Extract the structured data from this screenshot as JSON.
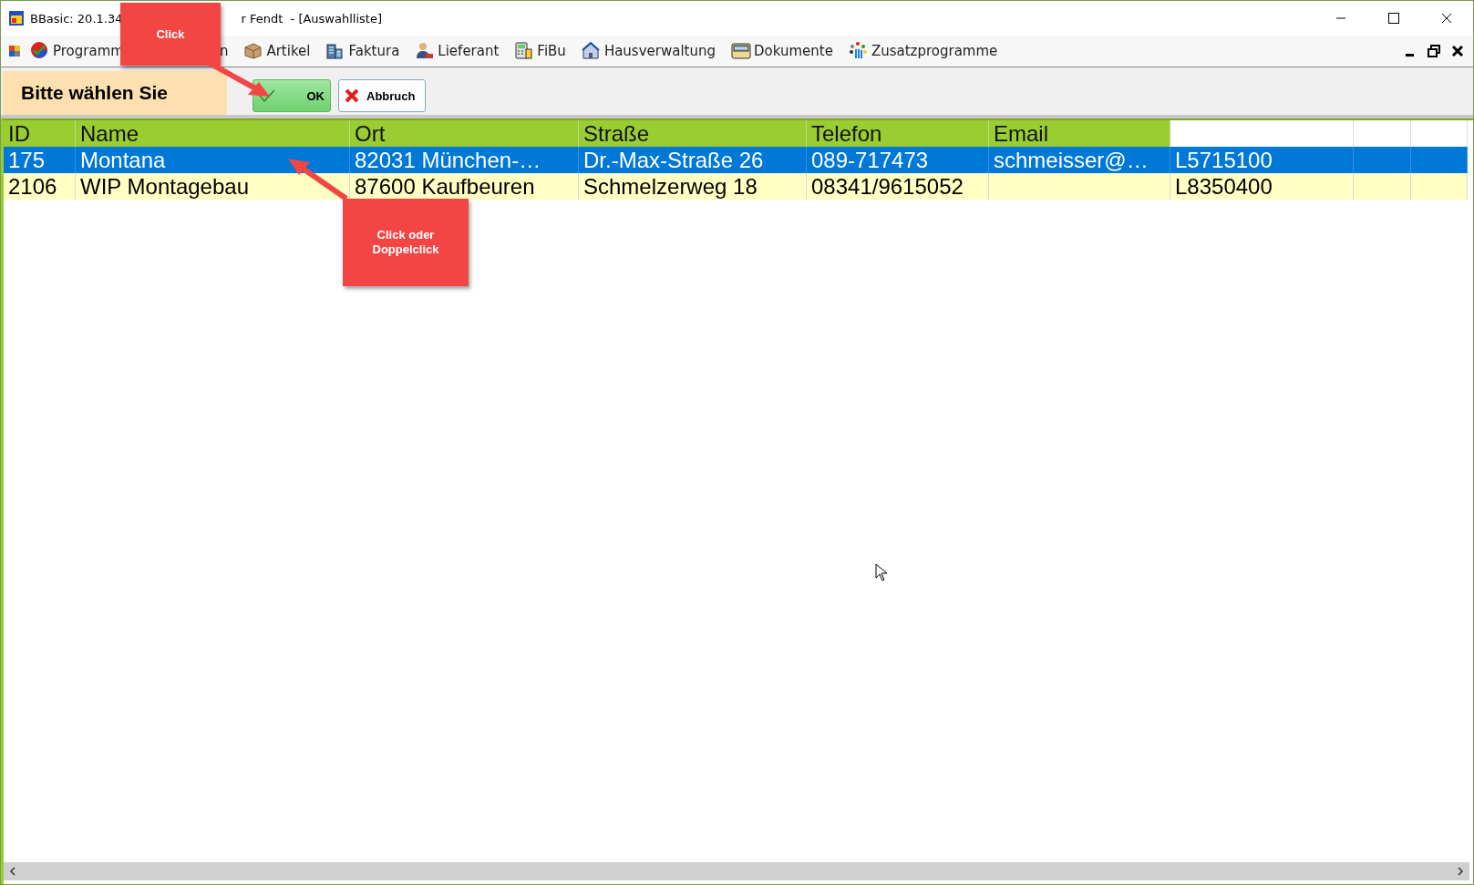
{
  "window": {
    "title_parts": [
      "BBasic: 20.1.34",
      "r Fendt  - [Auswahlliste]"
    ]
  },
  "menu": [
    {
      "label": "Programm"
    },
    {
      "label": "n"
    },
    {
      "label": "Artikel"
    },
    {
      "label": "Faktura"
    },
    {
      "label": "Lieferant"
    },
    {
      "label": "FiBu"
    },
    {
      "label": "Hausverwaltung"
    },
    {
      "label": "Dokumente"
    },
    {
      "label": "Zusatzprogramme"
    }
  ],
  "toolbar": {
    "heading": "Bitte wählen Sie",
    "buttons": [
      {
        "label": "OK",
        "kind": "ok"
      },
      {
        "label": "Abbruch",
        "kind": "cancel"
      }
    ]
  },
  "table": {
    "columns": [
      "ID",
      "Name",
      "Ort",
      "Straße",
      "Telefon",
      "Email"
    ],
    "rows": [
      {
        "selected": true,
        "cells": [
          "175",
          "Montana",
          "82031  München-…",
          "Dr.-Max-Straße 26",
          "089-717473",
          "schmeisser@…",
          "L5715100"
        ]
      },
      {
        "selected": false,
        "cells": [
          "2106",
          "WIP Montagebau",
          "87600 Kaufbeuren",
          "Schmelzerweg 18",
          "08341/9615052",
          "",
          "L8350400"
        ]
      }
    ]
  },
  "callouts": [
    {
      "text": "Click",
      "kind": "top"
    },
    {
      "text": "Click oder\nDoppelclick",
      "kind": "row"
    }
  ]
}
